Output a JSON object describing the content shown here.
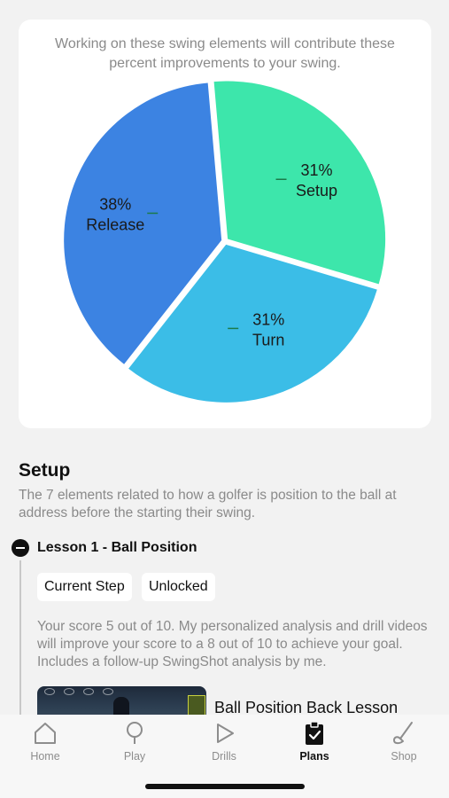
{
  "chart_card": {
    "caption": "Working on these swing elements will contribute these percent improvements to your swing."
  },
  "chart_data": {
    "type": "pie",
    "title": "",
    "slices": [
      {
        "label": "Setup",
        "value": 31,
        "display": "31%",
        "color": "#3de6ab"
      },
      {
        "label": "Turn",
        "value": 31,
        "display": "31%",
        "color": "#3bbde7"
      },
      {
        "label": "Release",
        "value": 38,
        "display": "38%",
        "color": "#3c83e2"
      }
    ]
  },
  "section": {
    "title": "Setup",
    "description": "The 7 elements related to how a golfer is position to the ball at address before the starting their swing."
  },
  "lesson": {
    "title": "Lesson 1 - Ball Position",
    "chip_current": "Current Step",
    "chip_unlocked": "Unlocked",
    "score_text": "Your score 5 out of 10. My personalized analysis and drill videos will improve your score to a 8 out of 10 to achieve your goal. Includes a follow-up SwingShot analysis by me.",
    "video_title": "Ball Position Back Lesson"
  },
  "tabbar": {
    "tabs": [
      {
        "label": "Home",
        "icon": "home-icon"
      },
      {
        "label": "Play",
        "icon": "pin-icon"
      },
      {
        "label": "Drills",
        "icon": "play-icon"
      },
      {
        "label": "Plans",
        "icon": "clipboard-check-icon"
      },
      {
        "label": "Shop",
        "icon": "golf-club-icon"
      }
    ],
    "active": "Plans"
  }
}
